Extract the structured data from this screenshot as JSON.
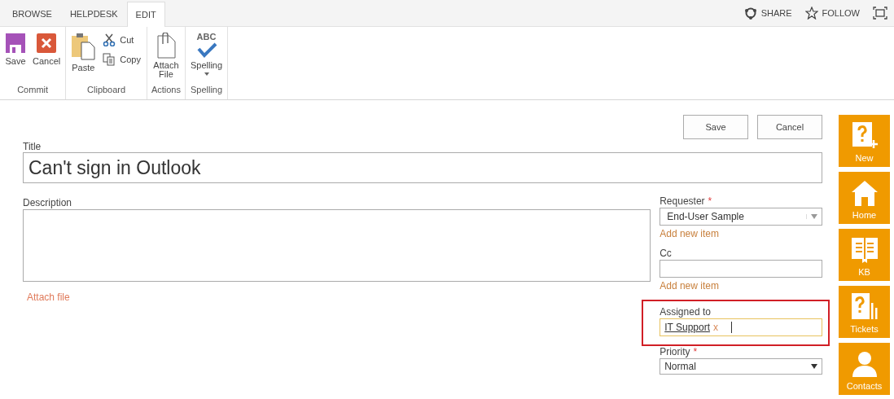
{
  "tabs": [
    {
      "label": "BROWSE",
      "selected": false
    },
    {
      "label": "HELPDESK",
      "selected": false
    },
    {
      "label": "EDIT",
      "selected": true
    }
  ],
  "top_actions": [
    {
      "kind": "share",
      "label": "SHARE"
    },
    {
      "kind": "follow",
      "label": "FOLLOW"
    },
    {
      "kind": "focus"
    }
  ],
  "ribbon": [
    {
      "label": "Commit",
      "items": [
        {
          "kind": "save",
          "label": "Save"
        },
        {
          "kind": "cancel",
          "label": "Cancel"
        }
      ]
    },
    {
      "label": "Clipboard",
      "items": [
        {
          "kind": "paste",
          "label": "Paste"
        },
        {
          "kind": "cut",
          "label": "Cut"
        },
        {
          "kind": "copy",
          "label": "Copy"
        }
      ]
    },
    {
      "label": "Actions",
      "items": [
        {
          "kind": "attach",
          "label": "Attach File"
        }
      ]
    },
    {
      "label": "Spelling",
      "items": [
        {
          "kind": "spelling",
          "label": "Spelling",
          "icon_text": "ABC"
        }
      ]
    }
  ],
  "form_buttons": [
    "Save",
    "Cancel"
  ],
  "title_field": {
    "label": "Title",
    "value": "Can't sign in Outlook"
  },
  "description_field": {
    "label": "Description"
  },
  "attach_link": "Attach file",
  "fields": [
    {
      "kind": "dropdown",
      "label": "Requester",
      "required_mark": "*",
      "value": "End-User Sample",
      "link": "Add new item",
      "highlighted": false
    },
    {
      "kind": "text",
      "label": "Cc",
      "link": "Add new item",
      "highlighted": false
    },
    {
      "kind": "people",
      "label": "Assigned to",
      "token": "IT Support",
      "remove": "x",
      "highlighted": true
    },
    {
      "kind": "select",
      "label": "Priority",
      "required_mark": "*",
      "value": "Normal",
      "highlighted": false
    }
  ],
  "tiles": [
    {
      "kind": "new",
      "label": "New"
    },
    {
      "kind": "home",
      "label": "Home"
    },
    {
      "kind": "kb",
      "label": "KB"
    },
    {
      "kind": "tickets",
      "label": "Tickets"
    },
    {
      "kind": "contacts",
      "label": "Contacts"
    }
  ]
}
